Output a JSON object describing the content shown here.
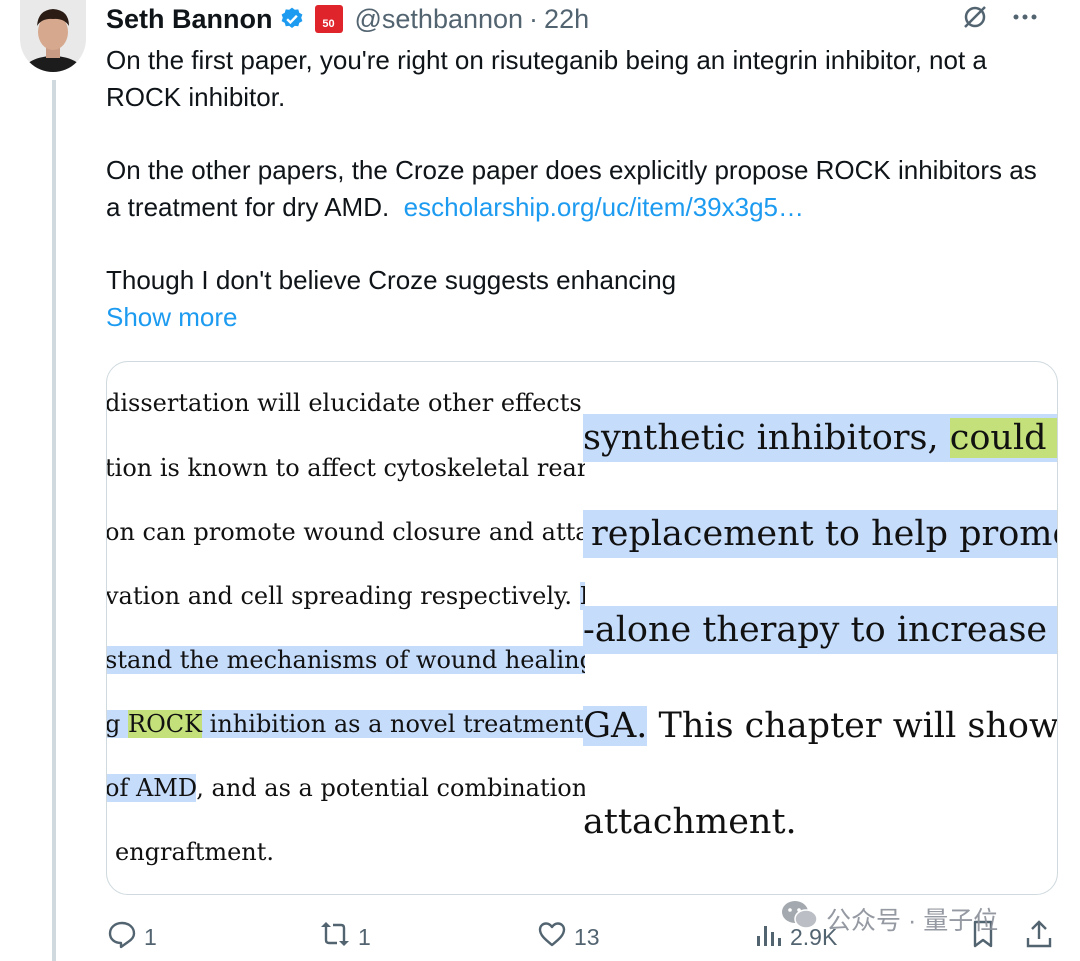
{
  "author": {
    "name": "Seth Bannon",
    "badge_text": "50",
    "handle": "@sethbannon",
    "separator": "·",
    "time": "22h"
  },
  "tweet": {
    "p1": "On the first paper, you're right on risuteganib being an integrin inhibitor, not a ROCK inhibitor.",
    "p2_text": "On the other papers, the Croze paper does explicitly propose ROCK inhibitors as a treatment for dry AMD.",
    "p2_link": "escholarship.org/uc/item/39x3g5…",
    "p3": "Though I don't believe Croze suggests enhancing",
    "show_more": "Show more"
  },
  "media_left": {
    "l1": "dissertation will elucidate other effects of",
    "l2": "tion is known to affect cytoskeletal rearra",
    "l3": "on can promote wound closure and attac",
    "l4a": "vation and cell spreading respectively. ",
    "l4b": "El",
    "l5": "stand the mechanisms of wound healing a",
    "l6a": "g ",
    "l6b": "ROCK",
    "l6c": " inhibition as a novel treatment fo",
    "l7a": "of AMD",
    "l7b": ", and as a potential combinational",
    "l8": "engraftment."
  },
  "media_right": {
    "r1a": "synthetic inhibitors, ",
    "r1b": "could p",
    "r2": "replacement to help promo",
    "r3": "-alone therapy to increase p",
    "r4a": "GA.",
    "r4b": " This chapter will show",
    "r5": "attachment."
  },
  "actions": {
    "replies": "1",
    "reposts": "1",
    "likes": "13",
    "views": "2.9K"
  },
  "watermark": {
    "text": "公众号 · 量子位"
  },
  "colors": {
    "link": "#1d9bf0",
    "muted": "#536471",
    "highlight_blue": "#c6dcfb",
    "highlight_green": "#c3e07a",
    "verified": "#1d9bf0",
    "badge": "#e0242c"
  },
  "icons": [
    "verified-icon",
    "mute-icon",
    "more-icon",
    "reply-icon",
    "repost-icon",
    "like-icon",
    "views-icon",
    "bookmark-icon",
    "share-icon",
    "wechat-icon"
  ]
}
